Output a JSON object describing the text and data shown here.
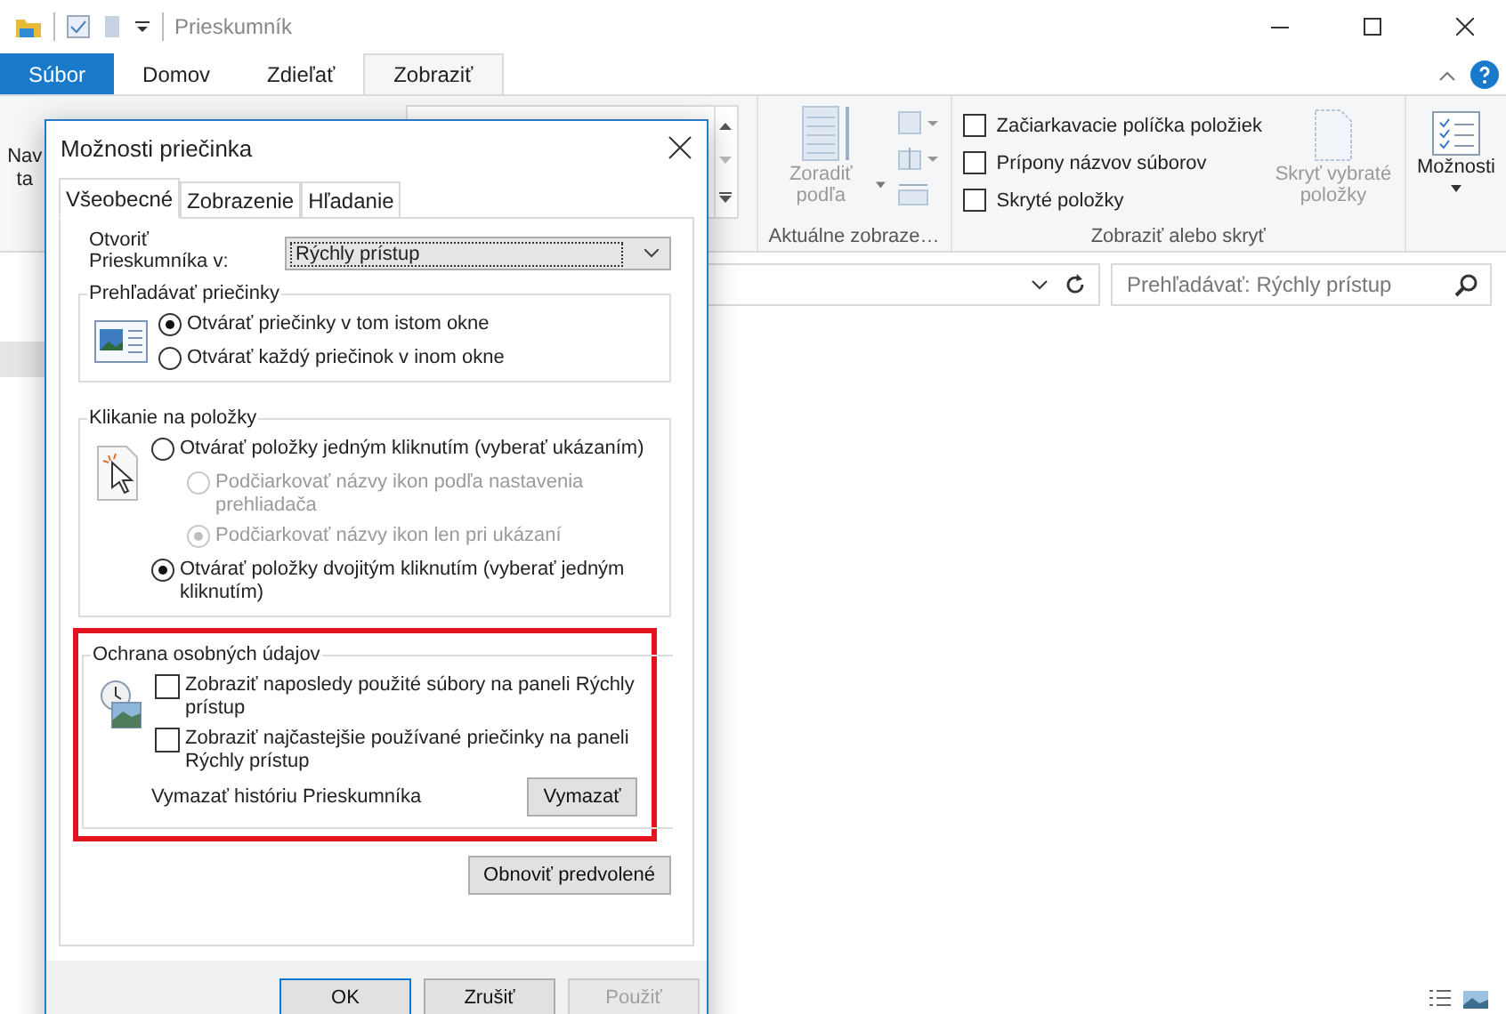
{
  "explorer": {
    "title": "Prieskumník",
    "ribbon_tabs": [
      {
        "label": "Súbor",
        "kind": "file",
        "selected": false
      },
      {
        "label": "Domov",
        "kind": "tab",
        "selected": false
      },
      {
        "label": "Zdieľať",
        "kind": "tab",
        "selected": false
      },
      {
        "label": "Zobraziť",
        "kind": "tab",
        "selected": true
      }
    ],
    "ribbon": {
      "nav_fragment": [
        "Nav",
        "ta"
      ],
      "sort": {
        "label": "Zoradiť podľa",
        "disabled": true
      },
      "current_view_group": "Aktuálne zobraze…",
      "checkboxes": [
        {
          "label": "Začiarkavacie políčka položiek",
          "checked": false
        },
        {
          "label": "Prípony názvov súborov",
          "checked": false
        },
        {
          "label": "Skryté položky",
          "checked": false
        }
      ],
      "hide_selected": {
        "label": "Skryť vybraté položky",
        "disabled": true
      },
      "show_hide_group": "Zobraziť alebo skryť",
      "options": "Možnosti"
    },
    "search": {
      "placeholder": "Prehľadávať: Rýchly prístup"
    }
  },
  "dialog": {
    "title": "Možnosti priečinka",
    "tabs": [
      {
        "label": "Všeobecné",
        "selected": true
      },
      {
        "label": "Zobrazenie",
        "selected": false
      },
      {
        "label": "Hľadanie",
        "selected": false
      }
    ],
    "open_in": {
      "label": "Otvoriť Prieskumníka v:",
      "value": "Rýchly prístup"
    },
    "browse_group": {
      "title": "Prehľadávať priečinky",
      "options": [
        {
          "label": "Otvárať priečinky v tom istom okne",
          "selected": true,
          "disabled": false
        },
        {
          "label": "Otvárať každý priečinok v inom okne",
          "selected": false,
          "disabled": false
        }
      ]
    },
    "click_group": {
      "title": "Klikanie na položky",
      "options": [
        {
          "label": "Otvárať položky jedným kliknutím (vyberať ukázaním)",
          "selected": false,
          "disabled": false,
          "children": [
            {
              "label": "Podčiarkovať názvy ikon podľa nastavenia prehliadača",
              "selected": false,
              "disabled": true
            },
            {
              "label": "Podčiarkovať názvy ikon len pri ukázaní",
              "selected": true,
              "disabled": true
            }
          ]
        },
        {
          "label": "Otvárať položky dvojitým kliknutím (vyberať jedným kliknutím)",
          "selected": true,
          "disabled": false
        }
      ]
    },
    "privacy_group": {
      "title": "Ochrana osobných údajov",
      "highlighted": true,
      "checkboxes": [
        {
          "label": "Zobraziť naposledy použité súbory na paneli Rýchly prístup",
          "checked": false
        },
        {
          "label": "Zobraziť najčastejšie používané priečinky na paneli Rýchly prístup",
          "checked": false
        }
      ],
      "clear_label": "Vymazať históriu Prieskumníka",
      "clear_button": "Vymazať"
    },
    "restore_button": "Obnoviť predvolené",
    "buttons": [
      {
        "label": "OK",
        "kind": "default",
        "disabled": false
      },
      {
        "label": "Zrušiť",
        "kind": "normal",
        "disabled": false
      },
      {
        "label": "Použiť",
        "kind": "normal",
        "disabled": true
      }
    ]
  }
}
